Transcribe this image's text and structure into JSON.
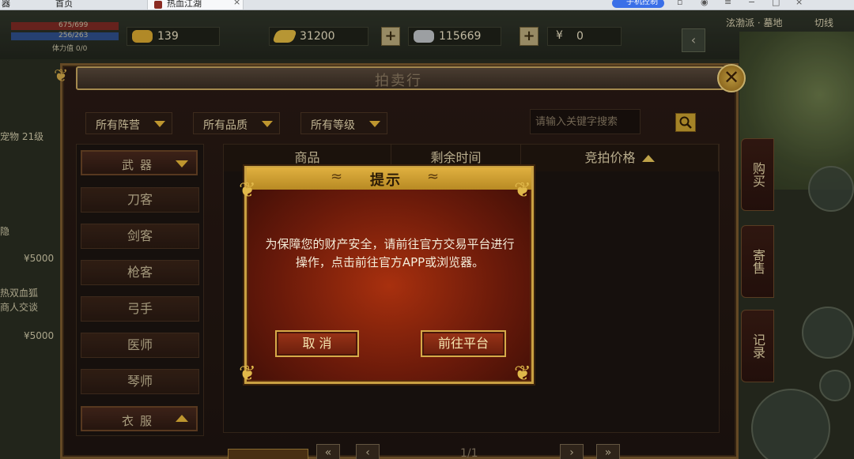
{
  "browser": {
    "tab_left_label": "器",
    "tab_home_label": "首页",
    "tab_game_label": "热血江湖",
    "tab_close": "×",
    "pill_label": "手机控制"
  },
  "hud": {
    "hp": "675/699",
    "mp": "256/263",
    "vitality": "体力值 0/0",
    "currencies": [
      {
        "name": "gold-ingot",
        "value": "139"
      },
      {
        "name": "gold-bar",
        "value": "31200"
      },
      {
        "name": "silver",
        "value": "115669"
      },
      {
        "name": "yuan",
        "value": "0"
      }
    ],
    "yuan_symbol": "¥",
    "location": "泫渤派 · 墓地",
    "switch_label": "切线",
    "plus": "+"
  },
  "left_game": {
    "pet_label": "宠物 21级",
    "tag1": "隐",
    "price1": "¥5000",
    "chat1": "热双血狐",
    "chat2": "商人交谈",
    "price2": "¥5000"
  },
  "side_tabs": {
    "buy": "购买",
    "sell": "寄售",
    "record": "记录"
  },
  "auction": {
    "title": "拍卖行",
    "close_symbol": "✕",
    "filters": [
      "所有阵营",
      "所有品质",
      "所有等级"
    ],
    "search_placeholder": "请输入关键字搜索",
    "categories": {
      "weapon_header": "武器",
      "items": [
        "刀客",
        "剑客",
        "枪客",
        "弓手",
        "医师",
        "琴师"
      ],
      "clothes_header": "衣服"
    },
    "table_headers": [
      "商品",
      "剩余时间",
      "竞拍价格"
    ],
    "pager": {
      "first": "«",
      "prev": "‹",
      "page": "1/1",
      "next": "›",
      "last": "»"
    }
  },
  "dialog": {
    "title": "提示",
    "message": "为保障您的财产安全，请前往官方交易平台进行操作，点击前往官方APP或浏览器。",
    "cancel_label": "取 消",
    "go_label": "前往平台"
  },
  "colors": {
    "gold": "#c9a042",
    "dialog_red": "#a8300e",
    "panel_dark": "#1c1410"
  }
}
